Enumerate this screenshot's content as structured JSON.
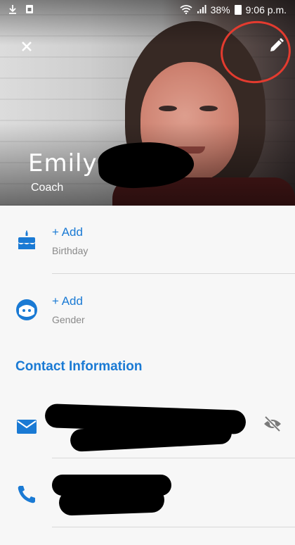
{
  "status_bar": {
    "left_icons": [
      "download-icon",
      "sim-icon"
    ],
    "battery": "38%",
    "time": "9:06 p.m."
  },
  "profile": {
    "first_name": "Emily",
    "role": "Coach"
  },
  "fields": [
    {
      "action": "+ Add",
      "label": "Birthday",
      "icon": "cake-icon"
    },
    {
      "action": "+ Add",
      "label": "Gender",
      "icon": "face-icon"
    }
  ],
  "contact": {
    "section_title": "Contact Information",
    "email_icon": "email-icon",
    "phone_icon": "phone-icon",
    "visibility_icon": "eye-off-icon"
  },
  "colors": {
    "accent": "#1a7ad4",
    "annotation": "#e33b2f"
  }
}
